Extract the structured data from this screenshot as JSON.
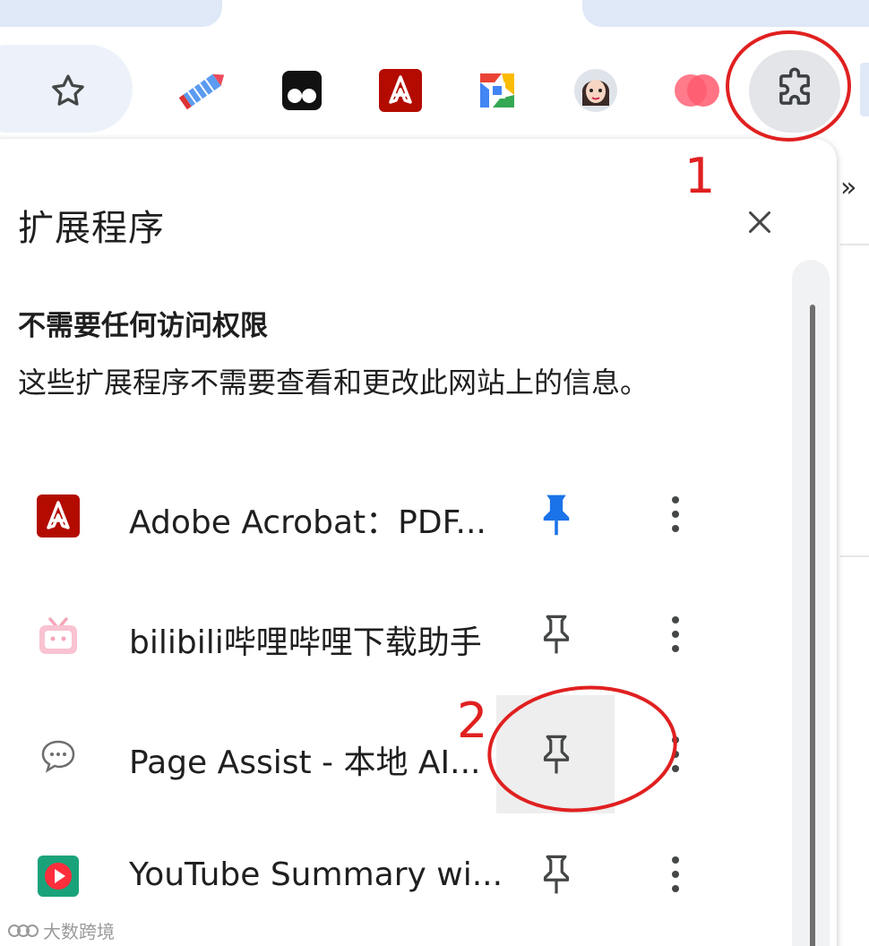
{
  "toolbar": {
    "bookmark_icon": "star-outline-icon",
    "extension_icons": [
      "pencil-extension-icon",
      "tampermonkey-icon",
      "adobe-acrobat-icon",
      "google-docs-offline-icon",
      "avatar-extension-icon",
      "pink-circles-extension-icon"
    ],
    "extensions_button_icon": "puzzle-icon",
    "overflow_chevron": "»"
  },
  "popup": {
    "title": "扩展程序",
    "close_icon": "close-icon",
    "section_heading": "不需要任何访问权限",
    "section_description": "这些扩展程序不需要查看和更改此网站上的信息。",
    "extensions": [
      {
        "name": "Adobe Acrobat：PDF...",
        "icon": "adobe-acrobat-icon",
        "pinned": true
      },
      {
        "name": "bilibili哔哩哔哩下载助手",
        "icon": "bilibili-tv-icon",
        "pinned": false
      },
      {
        "name": "Page Assist - 本地 AI...",
        "icon": "chat-bubble-icon",
        "pinned": false
      },
      {
        "name": "YouTube Summary wi...",
        "icon": "youtube-summary-icon",
        "pinned": false
      }
    ]
  },
  "annotations": {
    "step1": "1",
    "step2": "2",
    "color": "#e02020"
  },
  "watermark": "大数跨境",
  "colors": {
    "pinned_blue": "#1a73e8",
    "adobe_red": "#b30b00",
    "annotation_red": "#e02020"
  }
}
